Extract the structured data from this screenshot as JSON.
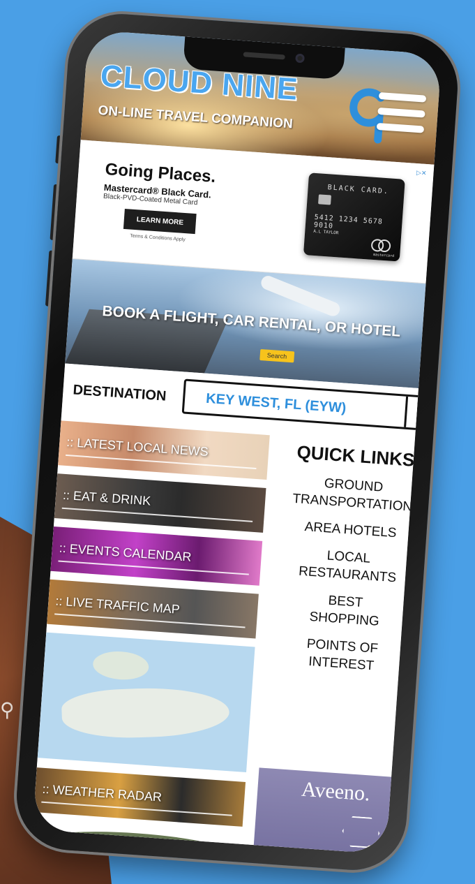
{
  "background": {
    "color": "#4a9fe6",
    "icon": "search-icon"
  },
  "header": {
    "title": "CLOUD NINE",
    "subtitle": "ON-LINE TRAVEL COMPANION",
    "logo_icon": "nine-logo-icon",
    "menu_icon": "hamburger-menu-icon"
  },
  "ad": {
    "headline": "Going Places.",
    "product": "Mastercard® Black Card.",
    "description": "Black-PVD-Coated Metal Card",
    "button": "LEARN MORE",
    "terms": "Terms & Conditions Apply",
    "card_brand": "BLACK CARD.",
    "card_number": "5412 1234 5678 9010",
    "card_holder": "A.L TAYLOR",
    "card_network": "mastercard"
  },
  "booking": {
    "banner_text": "BOOK A FLIGHT, CAR RENTAL, OR HOTEL",
    "search_button": "Search"
  },
  "destination": {
    "label": "DESTINATION",
    "value": "KEY WEST, FL (EYW)",
    "caret_icon": "chevron-down-icon"
  },
  "tiles": [
    {
      "label": ":: LATEST LOCAL NEWS"
    },
    {
      "label": ":: EAT & DRINK"
    },
    {
      "label": ":: EVENTS CALENDAR"
    },
    {
      "label": ":: LIVE TRAFFIC MAP"
    }
  ],
  "weather": {
    "label": ":: WEATHER RADAR"
  },
  "quick_links": {
    "title": "QUICK LINKS",
    "items": [
      "GROUND\nTRANSPORTATION",
      "AREA HOTELS",
      "LOCAL\nRESTAURANTS",
      "BEST\nSHOPPING",
      "POINTS OF\nINTEREST"
    ]
  },
  "aveeno_ad": {
    "logo": "Aveeno.",
    "product_label": "Aveeno."
  },
  "colors": {
    "accent_blue": "#2e8fdc",
    "logo_blue": "#4aa6ef",
    "aveeno_purple": "#8e89b3"
  }
}
